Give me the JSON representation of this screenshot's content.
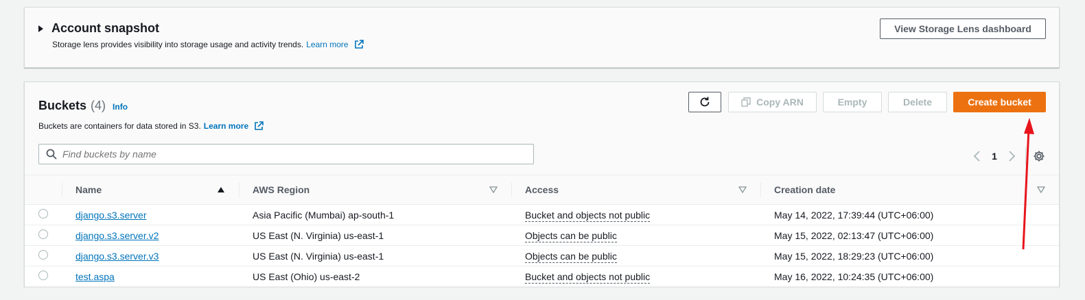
{
  "snapshot": {
    "title": "Account snapshot",
    "description": "Storage lens provides visibility into storage usage and activity trends.",
    "learn_more": "Learn more",
    "view_button": "View Storage Lens dashboard"
  },
  "buckets": {
    "title": "Buckets",
    "count": "(4)",
    "info": "Info",
    "description": "Buckets are containers for data stored in S3.",
    "learn_more": "Learn more",
    "actions": {
      "copy_arn": "Copy ARN",
      "empty": "Empty",
      "delete": "Delete",
      "create": "Create bucket"
    },
    "search_placeholder": "Find buckets by name",
    "page": "1",
    "columns": [
      "Name",
      "AWS Region",
      "Access",
      "Creation date"
    ],
    "rows": [
      {
        "name": "django.s3.server",
        "region": "Asia Pacific (Mumbai) ap-south-1",
        "access": "Bucket and objects not public",
        "created": "May 14, 2022, 17:39:44 (UTC+06:00)"
      },
      {
        "name": "django.s3.server.v2",
        "region": "US East (N. Virginia) us-east-1",
        "access": "Objects can be public",
        "created": "May 15, 2022, 02:13:47 (UTC+06:00)"
      },
      {
        "name": "django.s3.server.v3",
        "region": "US East (N. Virginia) us-east-1",
        "access": "Objects can be public",
        "created": "May 15, 2022, 18:29:23 (UTC+06:00)"
      },
      {
        "name": "test.aspa",
        "region": "US East (Ohio) us-east-2",
        "access": "Bucket and objects not public",
        "created": "May 16, 2022, 10:24:35 (UTC+06:00)"
      }
    ]
  },
  "colors": {
    "primary": "#ec7211",
    "link": "#0073bb",
    "annotation_arrow": "#e8141b"
  }
}
